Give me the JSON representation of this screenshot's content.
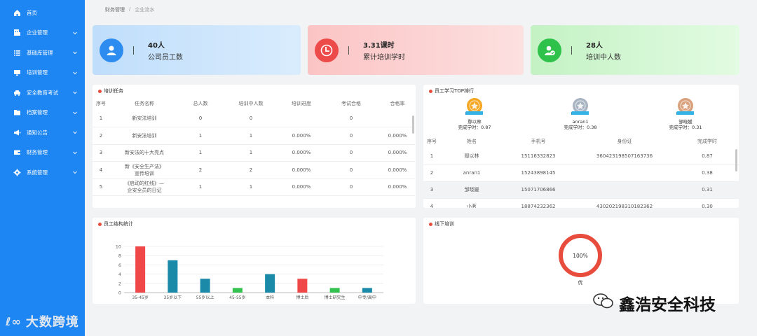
{
  "sidebar": {
    "items": [
      {
        "label": "首页",
        "icon": "home-icon",
        "has_chevron": false
      },
      {
        "label": "企业管理",
        "icon": "building-icon",
        "has_chevron": true
      },
      {
        "label": "基础库管理",
        "icon": "list-icon",
        "has_chevron": true
      },
      {
        "label": "培训管理",
        "icon": "monitor-icon",
        "has_chevron": true
      },
      {
        "label": "安全教育考试",
        "icon": "car-icon",
        "has_chevron": true
      },
      {
        "label": "档案管理",
        "icon": "folder-icon",
        "has_chevron": true
      },
      {
        "label": "通知公告",
        "icon": "megaphone-icon",
        "has_chevron": true
      },
      {
        "label": "财务管理",
        "icon": "wallet-icon",
        "has_chevron": true
      },
      {
        "label": "系统管理",
        "icon": "gear-icon",
        "has_chevron": true
      }
    ]
  },
  "breadcrumb": [
    "财务管理",
    "企业流水"
  ],
  "stats": [
    {
      "value": "40人",
      "label": "公司员工数",
      "icon": "user-icon",
      "color": "#2d8cf0"
    },
    {
      "value": "3.31课时",
      "label": "累计培训学时",
      "icon": "clock-icon",
      "color": "#ed4a4a"
    },
    {
      "value": "28人",
      "label": "培训中人数",
      "icon": "user-check-icon",
      "color": "#2fc24a"
    }
  ],
  "tasks": {
    "title": "培训任务",
    "columns": [
      "序号",
      "任务名称",
      "总人数",
      "培训中人数",
      "培训进度",
      "考试合格",
      "合格率"
    ],
    "rows": [
      [
        "1",
        "新安法培训",
        "0",
        "0",
        "",
        "0",
        ""
      ],
      [
        "2",
        "新安法培训",
        "1",
        "1",
        "0.000%",
        "0",
        "0.000%"
      ],
      [
        "3",
        "新安法的十大亮点",
        "1",
        "1",
        "0.000%",
        "0",
        "0.000%"
      ],
      [
        "4",
        "新《安全生产法》\n宣传培训",
        "2",
        "2",
        "0.000%",
        "0",
        "0.000%"
      ],
      [
        "5",
        "《启动的红线》—\n企安全员的日记",
        "1",
        "1",
        "0.000%",
        "0",
        "0.000%"
      ]
    ]
  },
  "ranking": {
    "title": "员工学习TOP排行",
    "podium": [
      {
        "name": "鄢以林",
        "time": "完成学时：0.87",
        "medal_color": "#f5a623"
      },
      {
        "name": "anran1",
        "time": "完成学时：0.38",
        "medal_color": "#a9b4c2"
      },
      {
        "name": "邹晓媛",
        "time": "完成学时：0.31",
        "medal_color": "#d9a07c"
      }
    ],
    "columns": [
      "序号",
      "姓名",
      "手机号",
      "身份证",
      "完成学时"
    ],
    "rows": [
      [
        "1",
        "鄢以林",
        "15116332823",
        "360423198507163736",
        "0.87"
      ],
      [
        "2",
        "anran1",
        "15243898145",
        "",
        "0.38"
      ],
      [
        "3",
        "邹晓媛",
        "15071706866",
        "",
        "0.31"
      ],
      [
        "4",
        "小茗",
        "18874232362",
        "430202198310182362",
        "0.30"
      ]
    ]
  },
  "structure": {
    "title": "员工结构统计",
    "accent": "#e74c3c"
  },
  "offline": {
    "title": "线下培训",
    "percent_text": "100%",
    "label": "优",
    "value": 1.0,
    "color": "#e74c3c"
  },
  "chart_data": {
    "type": "bar",
    "title": "",
    "xlabel": "",
    "ylabel": "",
    "ylim": [
      0,
      10
    ],
    "yticks": [
      "0",
      "2",
      "4",
      "6",
      "8",
      "10"
    ],
    "categories": [
      "35-45岁",
      "35岁以下",
      "55岁以上",
      "45-55岁",
      "本科",
      "博士后",
      "博士研究生",
      "中专/高中"
    ],
    "values": [
      10,
      7,
      3,
      1,
      4,
      3,
      1,
      1
    ],
    "colors": [
      "#f04848",
      "#1b8aa8",
      "#1b8aa8",
      "#33c24f",
      "#1b8aa8",
      "#f04848",
      "#33c24f",
      "#1b8aa8"
    ],
    "grid": true
  },
  "watermarks": {
    "left": "大数跨境",
    "right": "鑫浩安全科技"
  }
}
